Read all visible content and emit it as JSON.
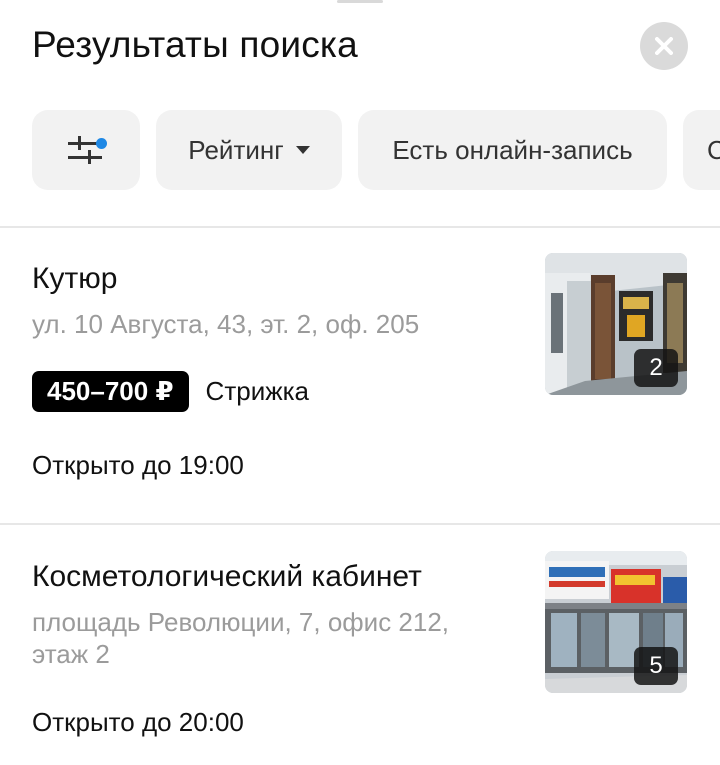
{
  "header": {
    "title": "Результаты поиска"
  },
  "filters": {
    "rating_label": "Рейтинг",
    "online_label": "Есть онлайн-запись",
    "more_label": "С"
  },
  "results": [
    {
      "name": "Кутюр",
      "address": "ул. 10 Августа, 43, эт. 2, оф. 205",
      "price": "450–700 ₽",
      "service": "Стрижка",
      "hours": "Открыто до 19:00",
      "photo_count": "2",
      "photo_icon": "salon-interior-photo"
    },
    {
      "name": "Косметологический кабинет",
      "address": "площадь Революции, 7, офис 212, этаж 2",
      "hours": "Открыто до 20:00",
      "photo_count": "5",
      "photo_icon": "building-facade-photo"
    }
  ],
  "colors": {
    "accent_dot": "#1e88e5",
    "chip_bg": "#f2f2f2",
    "price_bg": "#000000"
  }
}
